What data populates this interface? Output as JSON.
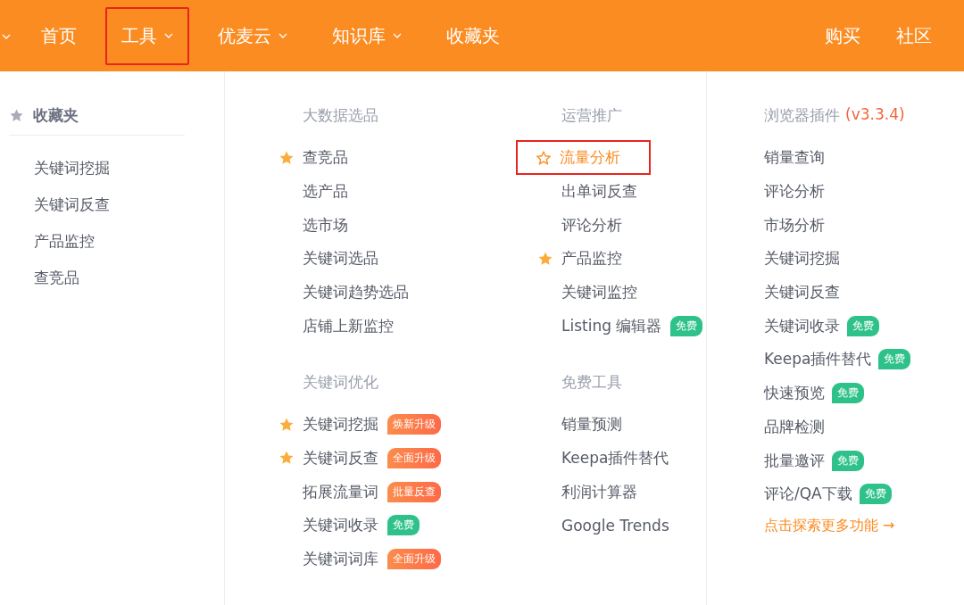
{
  "nav": {
    "left": [
      {
        "label": "首页",
        "dropdown": false,
        "highlighted": false
      },
      {
        "label": "工具",
        "dropdown": true,
        "highlighted": true
      },
      {
        "label": "优麦云",
        "dropdown": true,
        "highlighted": false
      },
      {
        "label": "知识库",
        "dropdown": true,
        "highlighted": false
      },
      {
        "label": "收藏夹",
        "dropdown": false,
        "highlighted": false
      }
    ],
    "right": [
      "购买",
      "社区"
    ]
  },
  "favorites": {
    "title": "收藏夹",
    "items": [
      "关键词挖掘",
      "关键词反查",
      "产品监控",
      "查竞品"
    ]
  },
  "groups": [
    {
      "title": "大数据选品",
      "items": [
        {
          "label": "查竞品",
          "starred": true,
          "highlighted": false
        },
        {
          "label": "选产品",
          "starred": false,
          "highlighted": false
        },
        {
          "label": "选市场",
          "starred": false,
          "highlighted": false
        },
        {
          "label": "关键词选品",
          "starred": false,
          "highlighted": false
        },
        {
          "label": "关键词趋势选品",
          "starred": false,
          "highlighted": false
        },
        {
          "label": "店铺上新监控",
          "starred": false,
          "highlighted": false
        }
      ]
    },
    {
      "title": "运营推广",
      "items": [
        {
          "label": "流量分析",
          "starred": false,
          "highlighted": true
        },
        {
          "label": "出单词反查",
          "starred": false,
          "highlighted": false
        },
        {
          "label": "评论分析",
          "starred": false,
          "highlighted": false
        },
        {
          "label": "产品监控",
          "starred": true,
          "highlighted": false
        },
        {
          "label": "关键词监控",
          "starred": false,
          "highlighted": false
        },
        {
          "label": "Listing 编辑器",
          "starred": false,
          "highlighted": false,
          "badge": {
            "text": "免费",
            "kind": "free"
          }
        }
      ]
    },
    {
      "title": "关键词优化",
      "items": [
        {
          "label": "关键词挖掘",
          "starred": true,
          "highlighted": false,
          "badge": {
            "text": "焕新升级",
            "kind": "upgrade"
          }
        },
        {
          "label": "关键词反查",
          "starred": true,
          "highlighted": false,
          "badge": {
            "text": "全面升级",
            "kind": "upgrade"
          }
        },
        {
          "label": "拓展流量词",
          "starred": false,
          "highlighted": false,
          "badge": {
            "text": "批量反查",
            "kind": "upgrade"
          }
        },
        {
          "label": "关键词收录",
          "starred": false,
          "highlighted": false,
          "badge": {
            "text": "免费",
            "kind": "free"
          }
        },
        {
          "label": "关键词词库",
          "starred": false,
          "highlighted": false,
          "badge": {
            "text": "全面升级",
            "kind": "upgrade"
          }
        }
      ]
    },
    {
      "title": "免费工具",
      "items": [
        {
          "label": "销量预测",
          "starred": false,
          "highlighted": false
        },
        {
          "label": "Keepa插件替代",
          "starred": false,
          "highlighted": false
        },
        {
          "label": "利润计算器",
          "starred": false,
          "highlighted": false
        },
        {
          "label": "Google Trends",
          "starred": false,
          "highlighted": false
        }
      ]
    }
  ],
  "plugins": {
    "title": "浏览器插件",
    "version": "(v3.3.4)",
    "items": [
      {
        "label": "销量查询"
      },
      {
        "label": "评论分析"
      },
      {
        "label": "市场分析"
      },
      {
        "label": "关键词挖掘"
      },
      {
        "label": "关键词反查"
      },
      {
        "label": "关键词收录",
        "badge": {
          "text": "免费",
          "kind": "free"
        }
      },
      {
        "label": "Keepa插件替代",
        "badge": {
          "text": "免费",
          "kind": "free"
        }
      },
      {
        "label": "快速预览",
        "badge": {
          "text": "免费",
          "kind": "free"
        }
      },
      {
        "label": "品牌检测"
      },
      {
        "label": "批量邀评",
        "badge": {
          "text": "免费",
          "kind": "free"
        }
      },
      {
        "label": "评论/QA下载",
        "badge": {
          "text": "免费",
          "kind": "free"
        }
      }
    ],
    "more_link": "点击探索更多功能 →"
  }
}
